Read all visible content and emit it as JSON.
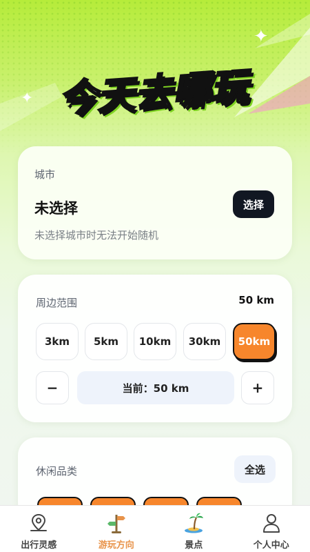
{
  "hero": {
    "title": "今天去哪玩"
  },
  "city_card": {
    "label": "城市",
    "value": "未选择",
    "select_button": "选择",
    "hint": "未选择城市时无法开始随机"
  },
  "range_card": {
    "label": "周边范围",
    "current_value": "50 km",
    "options": [
      "3km",
      "5km",
      "10km",
      "30km",
      "50km"
    ],
    "selected_option": "50km",
    "minus": "−",
    "plus": "+",
    "current_display": "当前：50 km"
  },
  "category_card": {
    "label": "休闲品类",
    "select_all": "全选"
  },
  "tabbar": {
    "items": [
      {
        "label": "出行灵感",
        "icon": "location-pin-icon"
      },
      {
        "label": "游玩方向",
        "icon": "signpost-icon",
        "active": true
      },
      {
        "label": "景点",
        "icon": "palm-island-icon"
      },
      {
        "label": "个人中心",
        "icon": "person-icon"
      }
    ]
  },
  "colors": {
    "accent_orange": "#f7862c",
    "dark_button": "#111722",
    "active_tab_label": "#e8934a",
    "hero_green": "#b6ec3a"
  }
}
